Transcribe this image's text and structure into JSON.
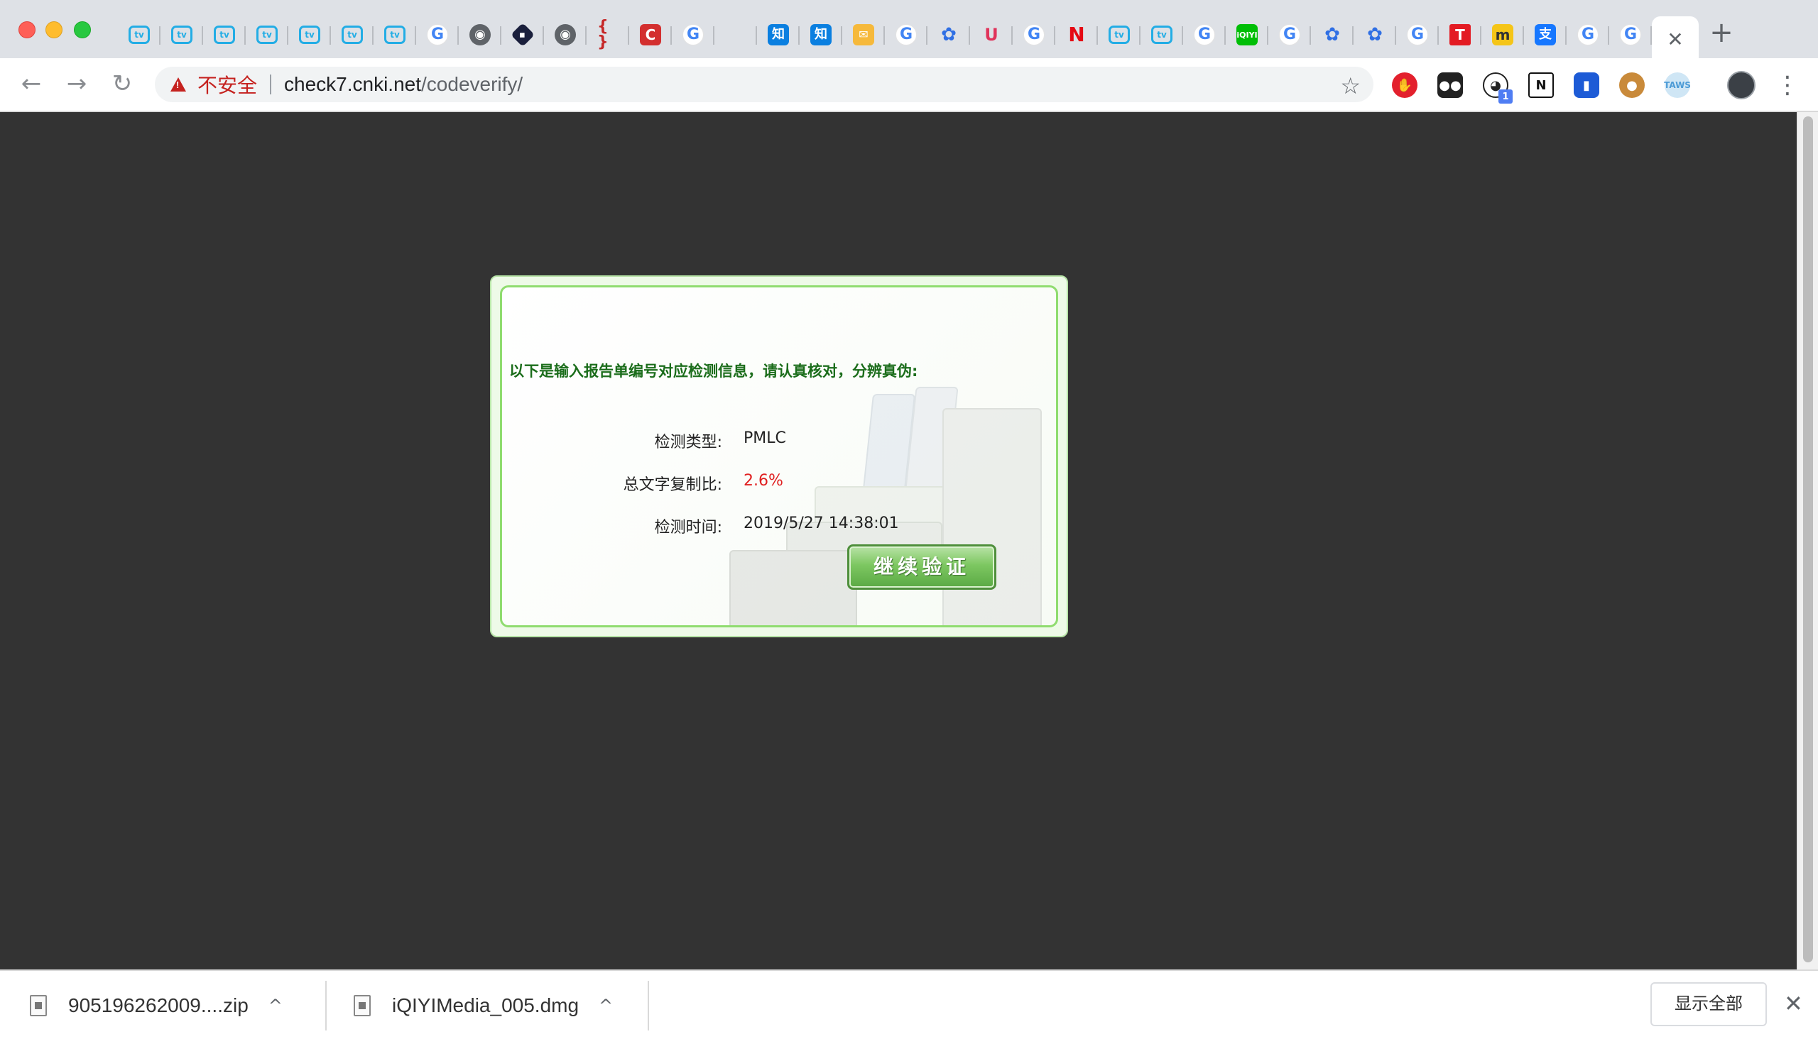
{
  "browser": {
    "tabs": [
      {
        "icon": "bilibili-icon",
        "glyph": "tv"
      },
      {
        "icon": "bilibili-icon",
        "glyph": "tv"
      },
      {
        "icon": "bilibili-icon",
        "glyph": "tv"
      },
      {
        "icon": "bilibili-icon",
        "glyph": "tv"
      },
      {
        "icon": "bilibili-icon",
        "glyph": "tv"
      },
      {
        "icon": "bilibili-icon",
        "glyph": "tv"
      },
      {
        "icon": "bilibili-icon",
        "glyph": "tv"
      },
      {
        "icon": "google-icon",
        "glyph": "G"
      },
      {
        "icon": "globe-icon",
        "glyph": "◉"
      },
      {
        "icon": "diamond-icon",
        "glyph": "◆"
      },
      {
        "icon": "globe-icon",
        "glyph": "◉"
      },
      {
        "icon": "braces-icon",
        "glyph": "{ }"
      },
      {
        "icon": "c-logo-icon",
        "glyph": "C"
      },
      {
        "icon": "google-icon",
        "glyph": "G"
      },
      {
        "icon": "blank-icon",
        "glyph": ""
      },
      {
        "icon": "zhihu-icon",
        "glyph": "知"
      },
      {
        "icon": "zhihu-icon",
        "glyph": "知"
      },
      {
        "icon": "mail-icon",
        "glyph": "✉"
      },
      {
        "icon": "google-icon",
        "glyph": "G"
      },
      {
        "icon": "baidu-paw-icon",
        "glyph": "✿"
      },
      {
        "icon": "magnet-icon",
        "glyph": "U"
      },
      {
        "icon": "google-icon",
        "glyph": "G"
      },
      {
        "icon": "netflix-icon",
        "glyph": "N"
      },
      {
        "icon": "bilibili-icon",
        "glyph": "tv"
      },
      {
        "icon": "bilibili-icon",
        "glyph": "tv"
      },
      {
        "icon": "google-icon",
        "glyph": "G"
      },
      {
        "icon": "iqiyi-icon",
        "glyph": "iQIYI"
      },
      {
        "icon": "google-icon",
        "glyph": "G"
      },
      {
        "icon": "baidu-paw-icon",
        "glyph": "✿"
      },
      {
        "icon": "baidu-paw-icon",
        "glyph": "✿"
      },
      {
        "icon": "google-icon",
        "glyph": "G"
      },
      {
        "icon": "t-logo-icon",
        "glyph": "T"
      },
      {
        "icon": "m-logo-icon",
        "glyph": "m"
      },
      {
        "icon": "alipay-icon",
        "glyph": "支"
      },
      {
        "icon": "google-icon",
        "glyph": "G"
      },
      {
        "icon": "google-icon",
        "glyph": "G"
      }
    ],
    "active_tab_close": "✕",
    "new_tab": "+",
    "nav": {
      "back": "←",
      "forward": "→",
      "reload": "↻"
    },
    "address": {
      "security_label": "不安全",
      "host": "check7.cnki.net",
      "path": "/codeverify/"
    },
    "bookmark_star": "☆",
    "extensions": {
      "adblock": "✋",
      "tampermonkey": "●●",
      "panda": "🐼",
      "panda_badge": "1",
      "notion": "N",
      "ruler": "▮",
      "cookie": "●",
      "cloud": "TAWS"
    },
    "menu": "⋮"
  },
  "verify": {
    "notice": "以下是输入报告单编号对应检测信息，请认真核对，分辨真伪:",
    "fields": [
      {
        "label": "检测类型:",
        "value": "PMLC"
      },
      {
        "label": "总文字复制比:",
        "value": "2.6%"
      },
      {
        "label": "检测时间:",
        "value": "2019/5/27 14:38:01"
      }
    ],
    "continue_label": "继续验证"
  },
  "downloads": {
    "items": [
      {
        "name": "905196262009....zip",
        "caret": "^"
      },
      {
        "name": "iQIYIMedia_005.dmg",
        "caret": "^"
      }
    ],
    "show_all": "显示全部",
    "close": "✕"
  },
  "colors": {
    "page_background": "#333333",
    "notice_green": "#1b6d1b",
    "ratio_red": "#e02020",
    "card_border": "#8fdc6f",
    "security_red": "#c5221f"
  }
}
